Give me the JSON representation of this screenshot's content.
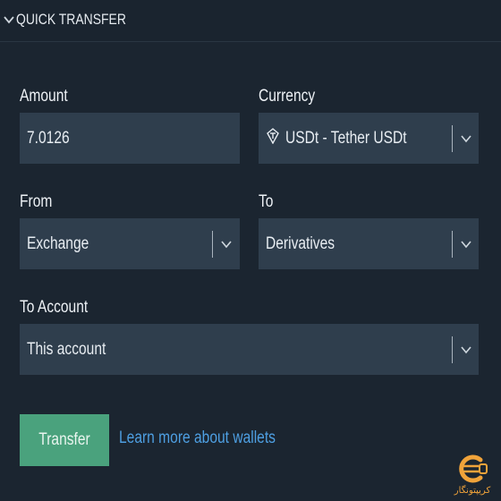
{
  "header": {
    "title": "QUICK TRANSFER"
  },
  "amount": {
    "label": "Amount",
    "value": "7.0126"
  },
  "currency": {
    "label": "Currency",
    "value": "USDt - Tether USDt",
    "icon": "tether-coin-icon"
  },
  "from": {
    "label": "From",
    "value": "Exchange"
  },
  "to": {
    "label": "To",
    "value": "Derivatives"
  },
  "to_account": {
    "label": "To Account",
    "value": "This account"
  },
  "actions": {
    "transfer_label": "Transfer",
    "learn_more_label": "Learn more about wallets"
  },
  "watermark": {
    "text": "کریپتونگار"
  },
  "colors": {
    "background": "#1b2530",
    "field": "#2f3e4d",
    "accent_button": "#4aa27d",
    "link": "#4e9fe2",
    "watermark": "#f0a33a"
  }
}
